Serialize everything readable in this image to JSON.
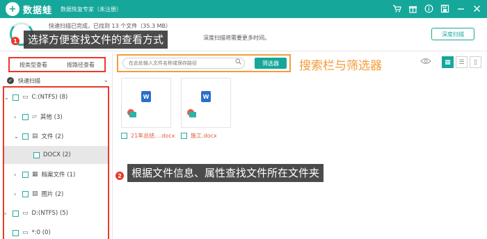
{
  "app": {
    "logo_mark": "+",
    "name": "数据蛙",
    "subtitle": "数据恢复专家（未注册）"
  },
  "titlebar_icons": [
    "cart-icon",
    "gift-icon",
    "info-icon",
    "save-icon",
    "minimize-icon",
    "close-icon"
  ],
  "status": {
    "line1": "快速扫描已完成，已找到 13 个文件（35.3 MB）",
    "line2": "深度扫描将需要更多时间。",
    "deep_scan_label": "深度扫描"
  },
  "annotations": {
    "badge1": "1",
    "text1": "选择方便查找文件的查看方式",
    "badge2": "2",
    "text2": "根据文件信息、属性查找文件所在文件夹",
    "search_text": "搜索栏与筛选器"
  },
  "view_tabs": {
    "by_type": "按类型查看",
    "by_path": "按路径查看"
  },
  "quick_scan": {
    "check": "✓",
    "label": "快速扫描"
  },
  "tree": [
    {
      "label": "C:(NTFS) (8)"
    },
    {
      "label": "其他 (3)"
    },
    {
      "label": "文件 (2)"
    },
    {
      "label": "DOCX (2)"
    },
    {
      "label": "档案文件 (1)"
    },
    {
      "label": "图片 (2)"
    },
    {
      "label": "D:(NTFS) (5)"
    },
    {
      "label": "*:0 (0)"
    }
  ],
  "search": {
    "placeholder": "在此处输入文件名称或保存路径",
    "filter_label": "筛选器"
  },
  "files": [
    {
      "name": "21年总结....docx",
      "icon": "W"
    },
    {
      "name": "施工.docx",
      "icon": "W"
    }
  ],
  "colors": {
    "brand": "#16a79b",
    "annotation_red": "#e8392b",
    "annotation_orange": "#f39c3a",
    "file_name": "#e05a3a"
  }
}
